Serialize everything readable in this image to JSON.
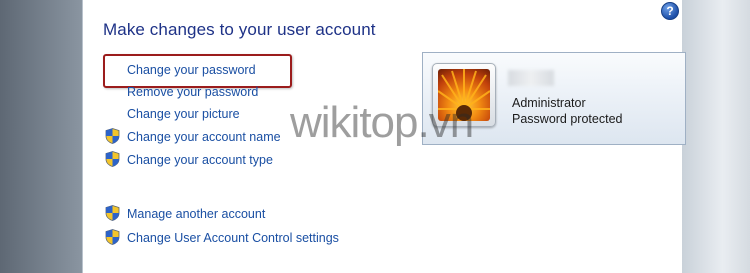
{
  "window": {
    "title": "Make changes to your user account",
    "help_icon": "?"
  },
  "tasks": [
    {
      "label": "Change your password",
      "shield": false,
      "highlighted": true
    },
    {
      "label": "Remove your password",
      "shield": false
    },
    {
      "label": "Change your picture",
      "shield": false
    },
    {
      "label": "Change your account name",
      "shield": true,
      "icon": "uac-shield-icon"
    },
    {
      "label": "Change your account type",
      "shield": true,
      "icon": "uac-shield-icon"
    }
  ],
  "other_tasks": [
    {
      "label": "Manage another account",
      "shield": true,
      "icon": "uac-shield-icon"
    },
    {
      "label": "Change User Account Control settings",
      "shield": true,
      "icon": "uac-shield-icon"
    }
  ],
  "account": {
    "type": "Administrator",
    "status": "Password protected",
    "picture": "flower-avatar-icon"
  },
  "watermark": "wikitop.vn",
  "colors": {
    "link": "#1a4fa3",
    "title": "#1e3287",
    "highlight": "#9b1c1c"
  }
}
